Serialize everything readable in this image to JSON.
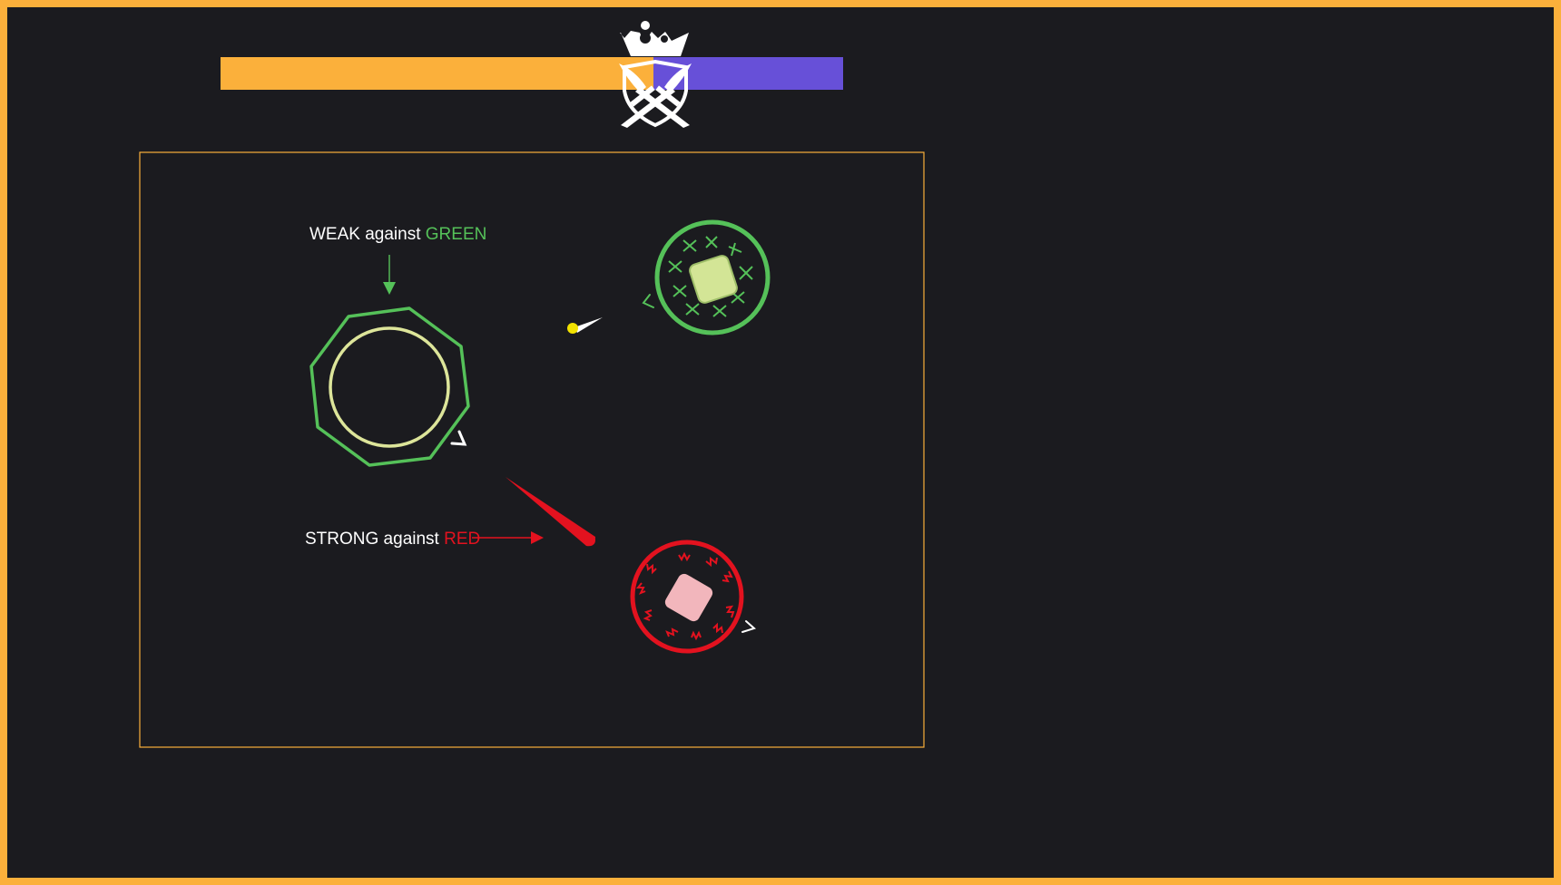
{
  "colors": {
    "frame": "#fbb03b",
    "background": "#1b1b1f",
    "team_orange": "#fbb03b",
    "team_purple": "#6750d8",
    "green": "#55c159",
    "red": "#e3121f",
    "player_core": "#dde59a",
    "green_core": "#d3e596",
    "red_core": "#f2b6bc"
  },
  "hud": {
    "balance": {
      "orange_share": 0.696,
      "purple_share": 0.304
    },
    "emblem_icon": "crown-crossed-swords-shield"
  },
  "tutorial": {
    "weak": {
      "prefix": "WEAK against ",
      "element": "GREEN"
    },
    "strong": {
      "prefix": "STRONG against ",
      "element": "RED"
    }
  }
}
